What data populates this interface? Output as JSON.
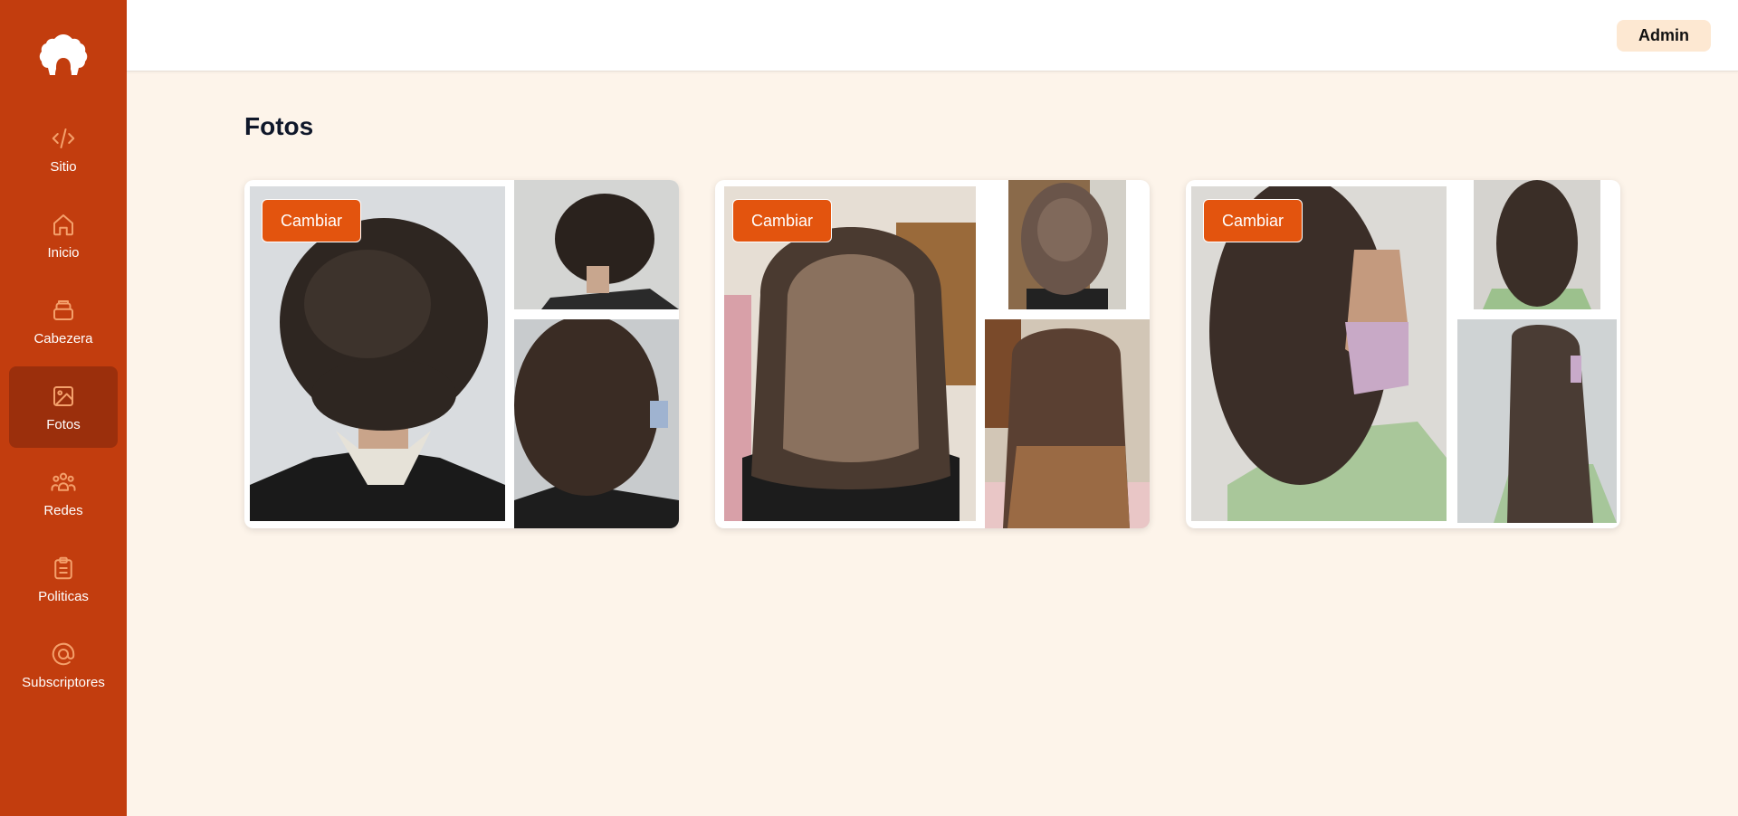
{
  "sidebar": {
    "logo_icon": "afro-hair-icon",
    "items": [
      {
        "label": "Sitio",
        "icon": "code-icon",
        "active": false
      },
      {
        "label": "Inicio",
        "icon": "home-icon",
        "active": false
      },
      {
        "label": "Cabezera",
        "icon": "layers-icon",
        "active": false
      },
      {
        "label": "Fotos",
        "icon": "image-icon",
        "active": true
      },
      {
        "label": "Redes",
        "icon": "users-icon",
        "active": false
      },
      {
        "label": "Politicas",
        "icon": "clipboard-icon",
        "active": false
      },
      {
        "label": "Subscriptores",
        "icon": "at-sign-icon",
        "active": false
      }
    ]
  },
  "header": {
    "admin_label": "Admin"
  },
  "main": {
    "title": "Fotos",
    "cards": [
      {
        "button_label": "Cambiar",
        "photos": [
          "curly-bob-back-photo",
          "curly-bob-side-photo",
          "curly-shoulder-length-photo"
        ]
      },
      {
        "button_label": "Cambiar",
        "photos": [
          "long-curly-highlights-photo",
          "wavy-medium-back-photo",
          "long-wavy-brown-photo"
        ]
      },
      {
        "button_label": "Cambiar",
        "photos": [
          "curly-side-profile-mask-photo",
          "curly-back-green-top-photo",
          "long-wavy-side-photo"
        ]
      }
    ]
  },
  "colors": {
    "sidebar": "#c23d0e",
    "sidebar_active": "#9b2f0c",
    "accent": "#e3540e",
    "background": "#fdf4ea",
    "admin_bg": "#fde8d2"
  }
}
